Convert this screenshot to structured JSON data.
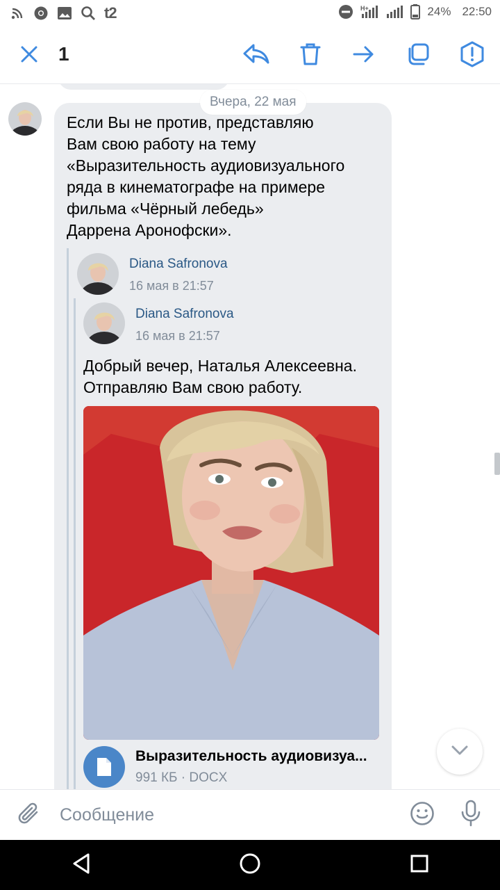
{
  "status_bar": {
    "carrier": "t2",
    "battery": "24%",
    "time": "22:50"
  },
  "toolbar": {
    "selected_count": "1",
    "icons": [
      "close-icon",
      "reply-icon",
      "delete-icon",
      "forward-icon",
      "copy-icon",
      "report-icon"
    ]
  },
  "chat": {
    "date_separator": "Вчера, 22 мая",
    "message": {
      "text": "Если Вы не против, представляю\nВам свою работу на тему\n«Выразительность аудиовизуального\nряда в кинематографе на примере\nфильма «Чёрный лебедь»\nДаррена Аронофски».",
      "forwarded_outer": {
        "author": "Diana Safronova",
        "date": "16 мая в 21:57"
      },
      "forwarded_inner": {
        "author": "Diana Safronova",
        "date": "16 мая в 21:57",
        "text": "Добрый вечер, Наталья Алексеевна.\nОтправляю Вам свою работу.",
        "document": {
          "title": "Выразительность аудиовизуа...",
          "meta": "991 КБ · DOCX"
        }
      }
    }
  },
  "composer": {
    "placeholder": "Сообщение"
  },
  "colors": {
    "accent": "#2a5885",
    "icon_blue": "#3f8ae0",
    "bubble": "#ebedf0",
    "doc_icon": "#4a86c8",
    "photo_bg": "#c9262a"
  }
}
